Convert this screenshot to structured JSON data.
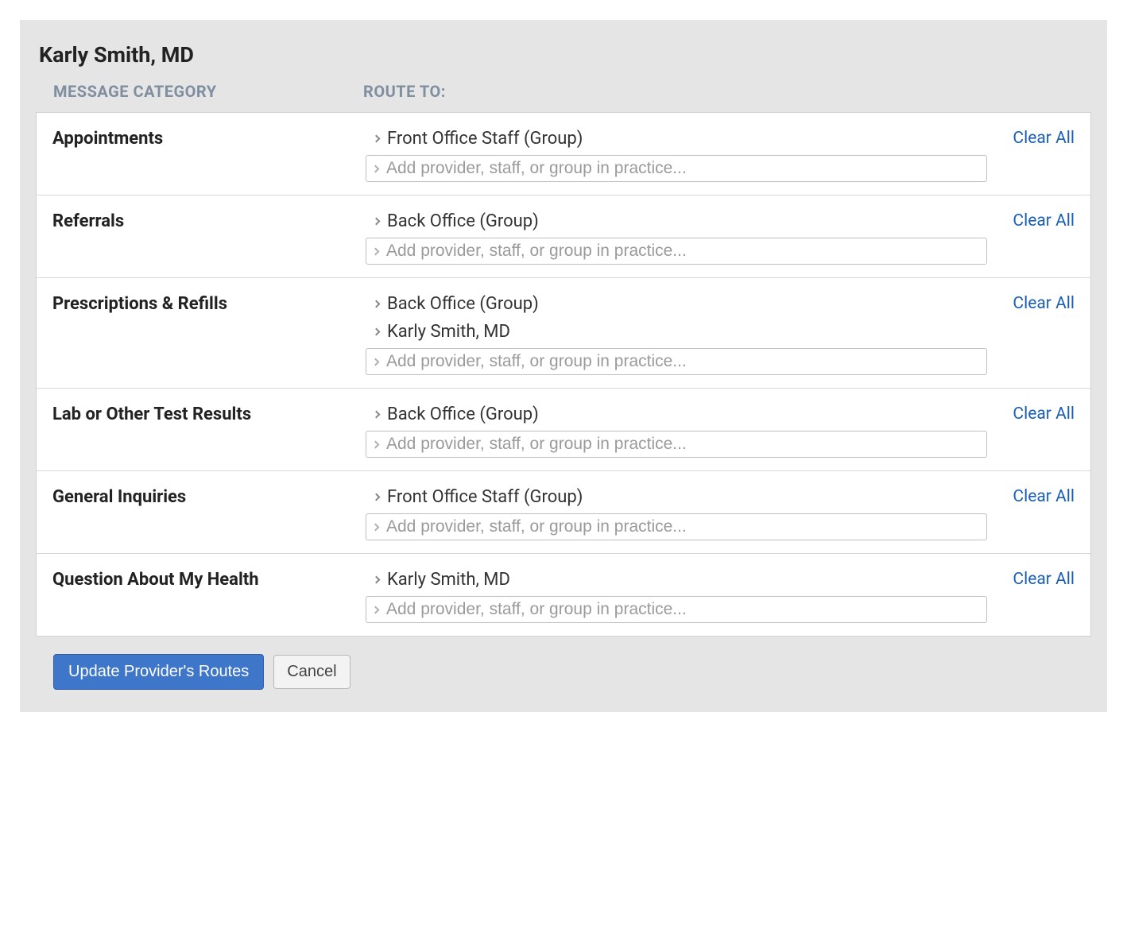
{
  "provider_name": "Karly Smith, MD",
  "headers": {
    "message_category": "MESSAGE CATEGORY",
    "route_to": "ROUTE TO:"
  },
  "add_placeholder": "Add provider, staff, or group in practice...",
  "clear_all_label": "Clear All",
  "rows": [
    {
      "category": "Appointments",
      "routes": [
        "Front Office Staff (Group)"
      ]
    },
    {
      "category": "Referrals",
      "routes": [
        "Back Office (Group)"
      ]
    },
    {
      "category": "Prescriptions & Refills",
      "routes": [
        "Back Office (Group)",
        "Karly Smith, MD"
      ]
    },
    {
      "category": "Lab or Other Test Results",
      "routes": [
        "Back Office (Group)"
      ]
    },
    {
      "category": "General Inquiries",
      "routes": [
        "Front Office Staff (Group)"
      ]
    },
    {
      "category": "Question About My Health",
      "routes": [
        "Karly Smith, MD"
      ]
    }
  ],
  "actions": {
    "update_label": "Update Provider's Routes",
    "cancel_label": "Cancel"
  }
}
